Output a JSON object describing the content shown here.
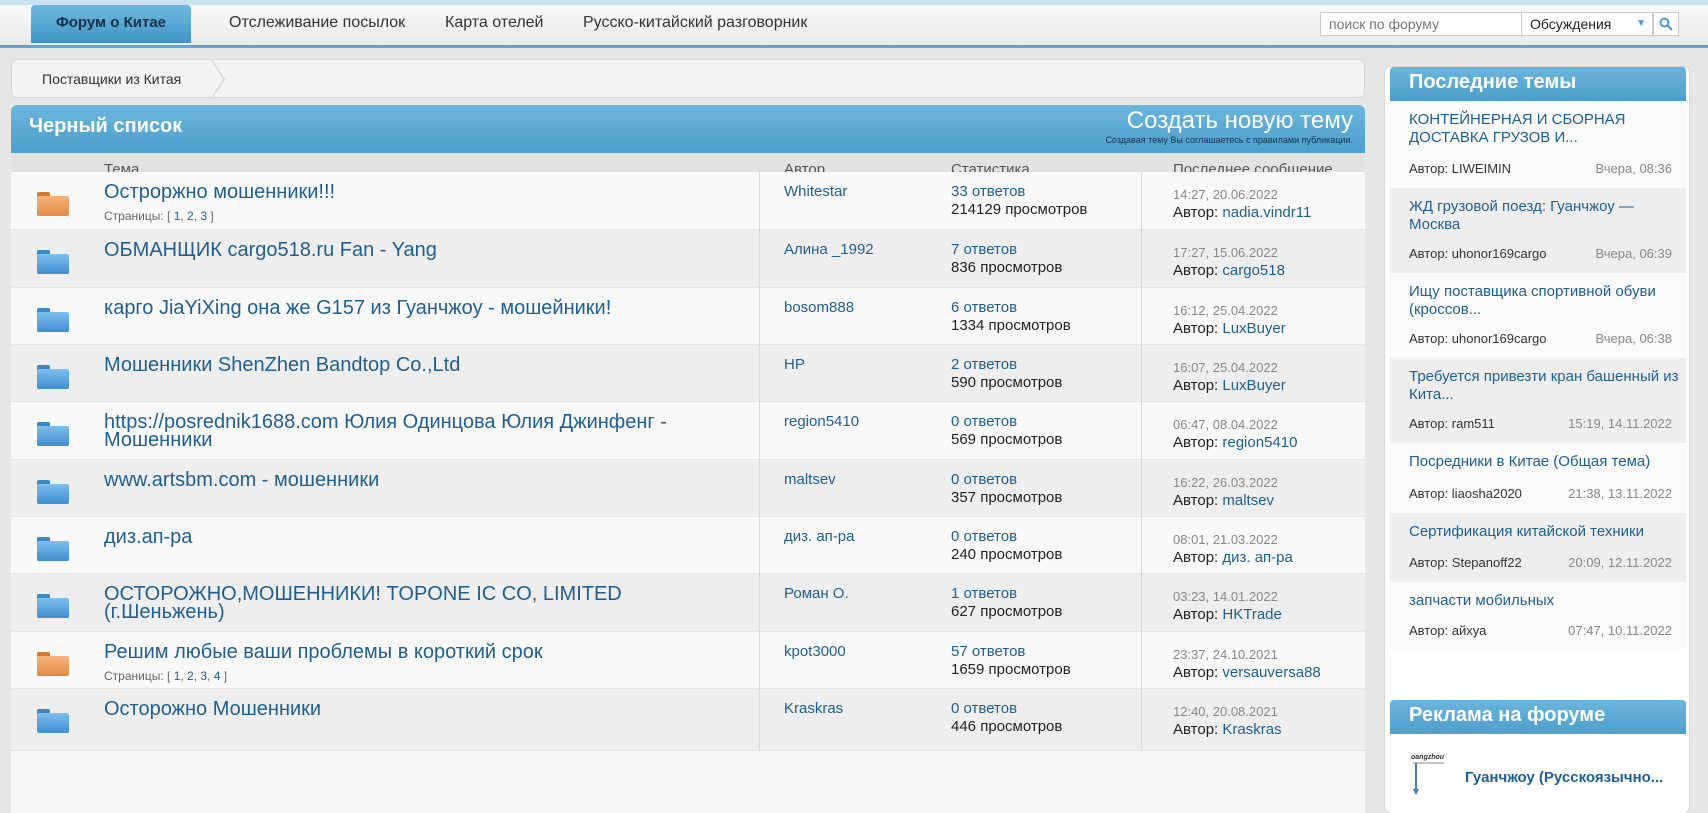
{
  "nav": {
    "home": "Форум о Китае",
    "links": [
      "Отслеживание посылок",
      "Карта отелей",
      "Русско-китайский разговорник"
    ],
    "search_placeholder": "поиск по форуму",
    "search_scope": "Обсуждения"
  },
  "breadcrumb": "Поставщики из Китая",
  "forum": {
    "title": "Черный список",
    "new_topic": "Создать новую тему",
    "new_topic_note": "Создавая тему Вы соглашаетесь с правилами публикации.",
    "columns": [
      "Тема",
      "Автор",
      "Статистика",
      "Последнее сообщение"
    ],
    "pages_label": "Страницы:",
    "last_author_label": "Автор:",
    "topics": [
      {
        "title": "Остроржно мошенники!!!",
        "pages": [
          "1",
          "2",
          "3"
        ],
        "folder": "orange",
        "author": "Whitestar",
        "replies": "33 ответов",
        "views": "214129 просмотров",
        "last_time": "14:27, 20.06.2022",
        "last_author": "nadia.vindr11"
      },
      {
        "title": "ОБМАНЩИК cargo518.ru Fan - Yang",
        "pages": [],
        "folder": "blue",
        "author": "Алина _1992",
        "replies": "7 ответов",
        "views": "836 просмотров",
        "last_time": "17:27, 15.06.2022",
        "last_author": "cargo518"
      },
      {
        "title": "карго JiaYiXing она же G157 из Гуанчжоу - мошейники!",
        "pages": [],
        "folder": "blue",
        "author": "bosom888",
        "replies": "6 ответов",
        "views": "1334 просмотров",
        "last_time": "16:12, 25.04.2022",
        "last_author": "LuxBuyer"
      },
      {
        "title": "Мошенники ShenZhen Bandtop Co.,Ltd",
        "pages": [],
        "folder": "blue",
        "author": "HP",
        "replies": "2 ответов",
        "views": "590 просмотров",
        "last_time": "16:07, 25.04.2022",
        "last_author": "LuxBuyer"
      },
      {
        "title": "https://posrednik1688.com Юлия Одинцова Юлия Джинфенг - Мошенники",
        "pages": [],
        "folder": "blue",
        "author": "region5410",
        "replies": "0 ответов",
        "views": "569 просмотров",
        "last_time": "06:47, 08.04.2022",
        "last_author": "region5410"
      },
      {
        "title": "www.artsbm.com - мошенники",
        "pages": [],
        "folder": "blue",
        "author": "maltsev",
        "replies": "0 ответов",
        "views": "357 просмотров",
        "last_time": "16:22, 26.03.2022",
        "last_author": "maltsev"
      },
      {
        "title": "диз.ап-ра",
        "pages": [],
        "folder": "blue",
        "author": "диз. ап-ра",
        "replies": "0 ответов",
        "views": "240 просмотров",
        "last_time": "08:01, 21.03.2022",
        "last_author": "диз. ап-ра"
      },
      {
        "title": "ОСТОРОЖНО,МОШЕННИКИ! TOPONE IC CO, LIMITED (г.Шеньжень)",
        "pages": [],
        "folder": "blue",
        "author": "Роман О.",
        "replies": "1 ответов",
        "views": "627 просмотров",
        "last_time": "03:23, 14.01.2022",
        "last_author": "HKTrade"
      },
      {
        "title": "Решим любые ваши проблемы в короткий срок",
        "pages": [
          "1",
          "2",
          "3",
          "4"
        ],
        "folder": "orange",
        "author": "kpot3000",
        "replies": "57 ответов",
        "views": "1659 просмотров",
        "last_time": "23:37, 24.10.2021",
        "last_author": "versauversa88"
      },
      {
        "title": "Осторожно Мошенники",
        "pages": [],
        "folder": "blue",
        "author": "Kraskras",
        "replies": "0 ответов",
        "views": "446 просмотров",
        "last_time": "12:40, 20.08.2021",
        "last_author": "Kraskras"
      }
    ]
  },
  "sidebar": {
    "latest_title": "Последние темы",
    "author_label": "Автор:",
    "latest": [
      {
        "title": "КОНТЕЙНЕРНАЯ И СБОРНАЯ ДОСТАВКА ГРУЗОВ И...",
        "author": "LIWEIMIN",
        "date": "Вчера, 08:36"
      },
      {
        "title": "ЖД грузовой поезд: Гуанчжоу — Москва",
        "author": "uhonor169cargo",
        "date": "Вчера, 06:39"
      },
      {
        "title": "Ищу поставщика спортивной обуви (кроссов...",
        "author": "uhonor169cargo",
        "date": "Вчера, 06:38"
      },
      {
        "title": "Требуется привезти кран башенный из Кита...",
        "author": "ram511",
        "date": "15:19, 14.11.2022"
      },
      {
        "title": "Посредники в Китае (Общая тема)",
        "author": "liaosha2020",
        "date": "21:38, 13.11.2022"
      },
      {
        "title": "Сертификация китайской техники",
        "author": "Stepanoff22",
        "date": "20:09, 12.11.2022"
      },
      {
        "title": "запчасти мобильных",
        "author": "айхуа",
        "date": "07:47, 10.11.2022"
      }
    ],
    "ad_title": "Реклама на форуме",
    "ad_text": "Гуанчжоу (Русскоязычно...",
    "ad_logo_text": "oangzhou"
  },
  "colors": {
    "accent": "#5aa9d4",
    "link": "#1e5f93",
    "folder_blue": "#5aa6e0",
    "folder_orange": "#e9955a"
  }
}
